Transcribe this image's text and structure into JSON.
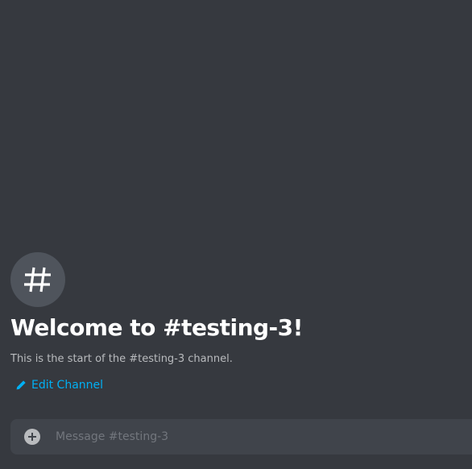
{
  "channel": {
    "icon": "hashtag-icon",
    "welcome_title": "Welcome to #testing-3!",
    "welcome_subtitle": "This is the start of the #testing-3 channel.",
    "edit_label": "Edit Channel",
    "edit_icon": "pencil-icon"
  },
  "composer": {
    "attach_icon": "plus-circle-icon",
    "placeholder": "Message #testing-3"
  },
  "colors": {
    "background": "#36393f",
    "icon_circle": "#4f545c",
    "title": "#ffffff",
    "subtitle": "#b9bbbe",
    "link": "#00b0f4",
    "composer_bg": "#40444b",
    "placeholder": "#72767d"
  }
}
